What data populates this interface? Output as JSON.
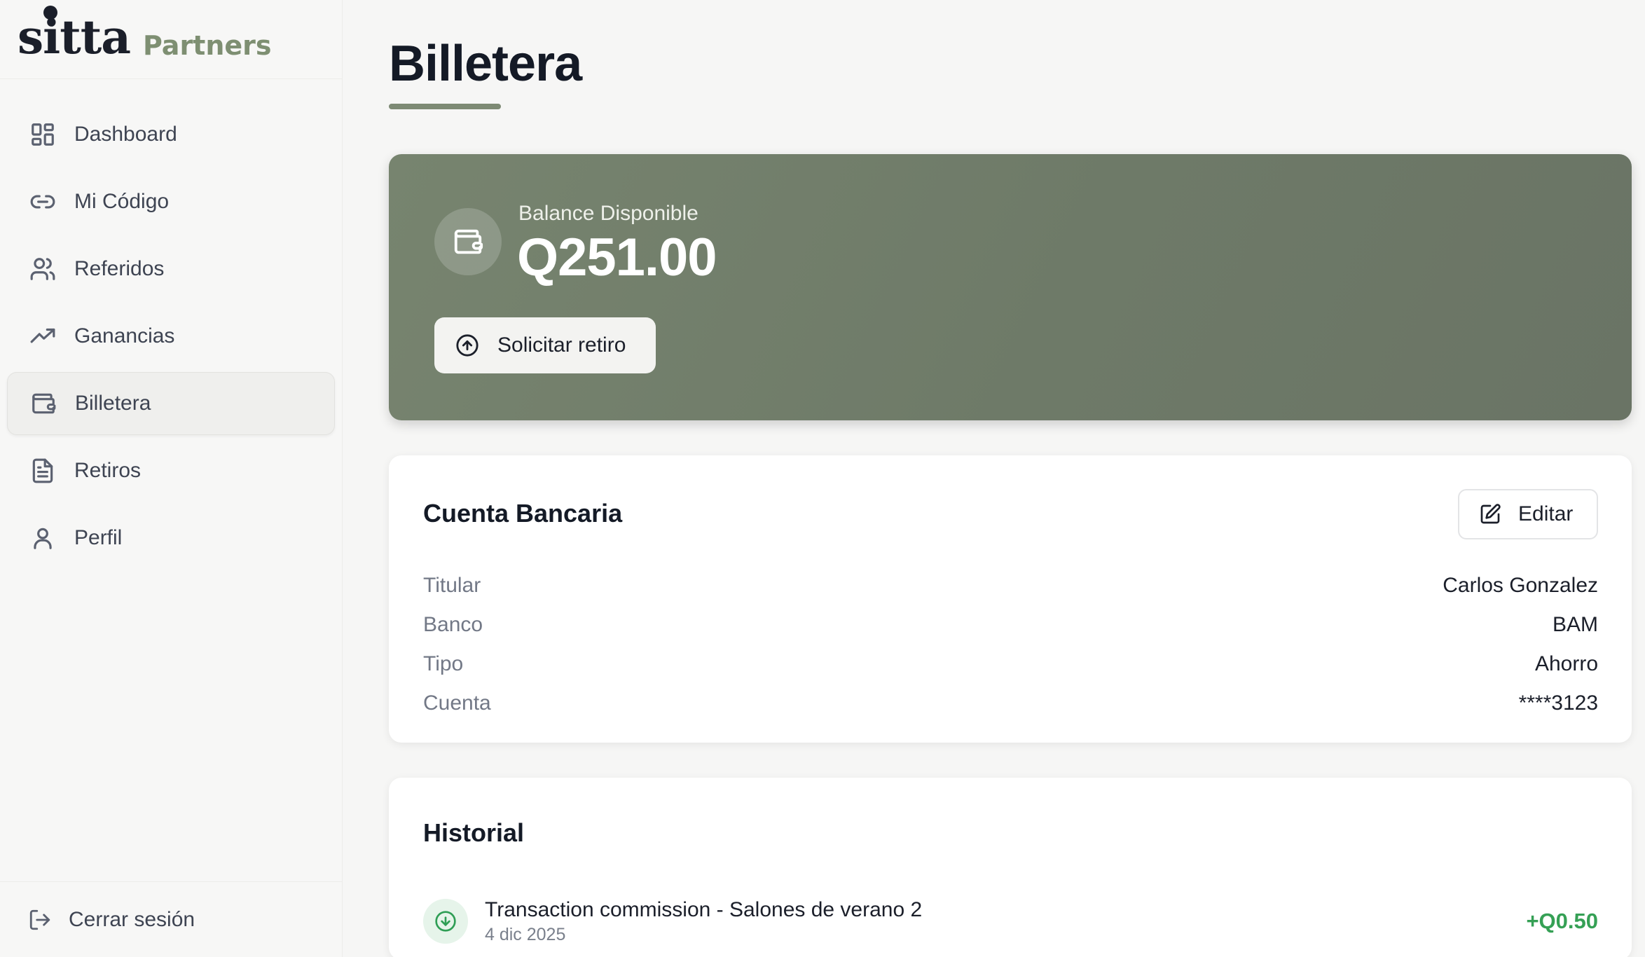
{
  "brand": {
    "logo": "sitta",
    "sub": "Partners"
  },
  "nav": {
    "items": [
      {
        "label": "Dashboard",
        "icon": "dashboard-grid-icon"
      },
      {
        "label": "Mi Código",
        "icon": "link-icon"
      },
      {
        "label": "Referidos",
        "icon": "users-icon"
      },
      {
        "label": "Ganancias",
        "icon": "trending-up-icon"
      },
      {
        "label": "Billetera",
        "icon": "wallet-icon",
        "active": true
      },
      {
        "label": "Retiros",
        "icon": "document-icon"
      },
      {
        "label": "Perfil",
        "icon": "user-icon"
      }
    ],
    "logout": "Cerrar sesión"
  },
  "page": {
    "title": "Billetera"
  },
  "balance": {
    "label": "Balance Disponible",
    "value": "Q251.00",
    "withdraw_label": "Solicitar retiro"
  },
  "bank": {
    "title": "Cuenta Bancaria",
    "edit_label": "Editar",
    "rows": [
      {
        "key": "Titular",
        "value": "Carlos Gonzalez"
      },
      {
        "key": "Banco",
        "value": "BAM"
      },
      {
        "key": "Tipo",
        "value": "Ahorro"
      },
      {
        "key": "Cuenta",
        "value": "****3123"
      }
    ]
  },
  "history": {
    "title": "Historial",
    "items": [
      {
        "title": "Transaction commission - Salones de verano 2",
        "date": "4 dic 2025",
        "amount": "+Q0.50"
      }
    ]
  },
  "colors": {
    "accent": "#7d8a74",
    "card": "#717d6b",
    "positive": "#35a055"
  }
}
